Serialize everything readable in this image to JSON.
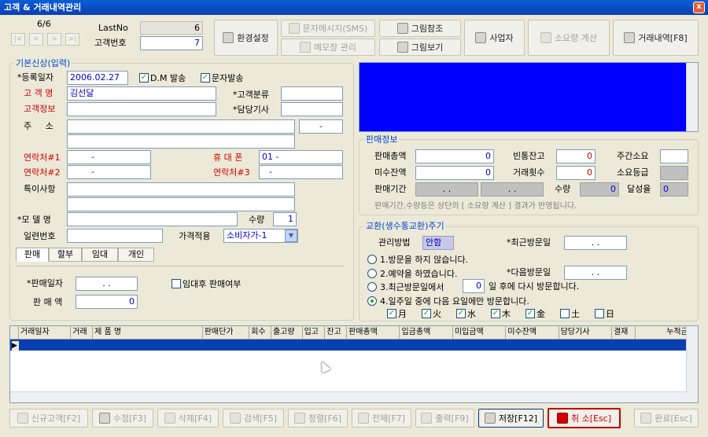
{
  "window": {
    "title": "고객 & 거래내역관리",
    "close_label": "x"
  },
  "nav": {
    "counter": "6/6",
    "lastno_label": "LastNo",
    "lastno_value": "6",
    "custno_label": "고객번호",
    "custno_value": "7",
    "first": "|<",
    "prev": "<",
    "next": ">",
    "last": ">|"
  },
  "toolbar": {
    "env": "환경설정",
    "sms": "문자메시지(SMS)",
    "memo": "메모장 관리",
    "picref": "그림참조",
    "picview": "그림보기",
    "biz": "사업자",
    "usage": "소요량 계산",
    "history": "거래내역[F8]"
  },
  "basic": {
    "title": "기본신상(입력)",
    "reg_label": "*등록일자",
    "reg_value": "2006.02.27",
    "dm_label": "D.M 발송",
    "sms_label": "문자발송",
    "name_label": "고 객 명",
    "name_value": "김선달",
    "cat_label": "*고객분류",
    "info_label": "고객정보",
    "tech_label": "*담당기사",
    "addr_label": "주     소",
    "addr_zip": "-",
    "c1_label": "연락처#1",
    "c1_value": "-",
    "mobile_label": "휴 대 폰",
    "mobile_value": "01 -",
    "c2_label": "연락처#2",
    "c2_value": "-",
    "c3_label": "연락처#3",
    "c3_value": "-",
    "note_label": "특이사항",
    "model_label": "*모 델 명",
    "qty_label": "수량",
    "qty_value": "1",
    "serial_label": "일련번호",
    "price_label": "가격적용",
    "price_value": "소비자가-1",
    "tabs": [
      "판매",
      "할부",
      "임대",
      "개인"
    ],
    "saledate_label": "*판매일자",
    "saledate_value": ".  .",
    "amount_label": "판 매 액",
    "amount_value": "0",
    "rent_label": "임대후 판매여부"
  },
  "sales": {
    "title": "판매정보",
    "total_label": "판매총액",
    "total_value": "0",
    "bottle_label": "빈통잔고",
    "bottle_value": "0",
    "weekly_label": "주간소요",
    "unpaid_label": "미수잔액",
    "unpaid_value": "0",
    "count_label": "거래횟수",
    "count_value": "0",
    "grade_label": "소요등급",
    "period_label": "판매기간",
    "period_from": ".  .",
    "period_to": ".  .",
    "qty_label": "수량",
    "qty_value": "0",
    "rate_label": "달성율",
    "rate_value": "0",
    "note": "판매기간,수량등은 상단의 [ 소요량 계산 ] 결과가 반영됩니다."
  },
  "cycle": {
    "title": "교환(생수통교환)주기",
    "method_label": "관리방법",
    "method_value": "안함",
    "lastvisit_label": "*최근방문일",
    "lastvisit_value": ".  .",
    "nextvisit_label": "*다음방문일",
    "nextvisit_value": ".  .",
    "opt1": "1.방문을 하지 않습니다.",
    "opt2": "2.예약을 하였습니다.",
    "opt3a": "3.최근방문일에서",
    "opt3_value": "0",
    "opt3b": "일 후에 다시 방문합니다.",
    "opt4": "4.일주일 중에 다음 요일에만 방문합니다.",
    "days": [
      {
        "label": "月",
        "checked": true
      },
      {
        "label": "火",
        "checked": true
      },
      {
        "label": "水",
        "checked": true
      },
      {
        "label": "木",
        "checked": true
      },
      {
        "label": "金",
        "checked": true
      },
      {
        "label": "土",
        "checked": false
      },
      {
        "label": "日",
        "checked": false
      }
    ]
  },
  "grid": {
    "columns": [
      "거래일자",
      "거래",
      "제  품  명",
      "판매단가",
      "회수",
      "출고량",
      "입고",
      "잔고",
      "판매총액",
      "입금총액",
      "미입금액",
      "미수잔액",
      "담당기사",
      "결재",
      "누적금액"
    ]
  },
  "buttons": {
    "new": "신규고객[F2]",
    "edit": "수정[F3]",
    "delete": "삭제[F4]",
    "search": "검색[F5]",
    "sort": "정렬[F6]",
    "all": "전체[F7]",
    "print": "출력[F9]",
    "save": "저장[F12]",
    "cancel": "취 소[Esc]",
    "done": "완료[Esc]"
  }
}
